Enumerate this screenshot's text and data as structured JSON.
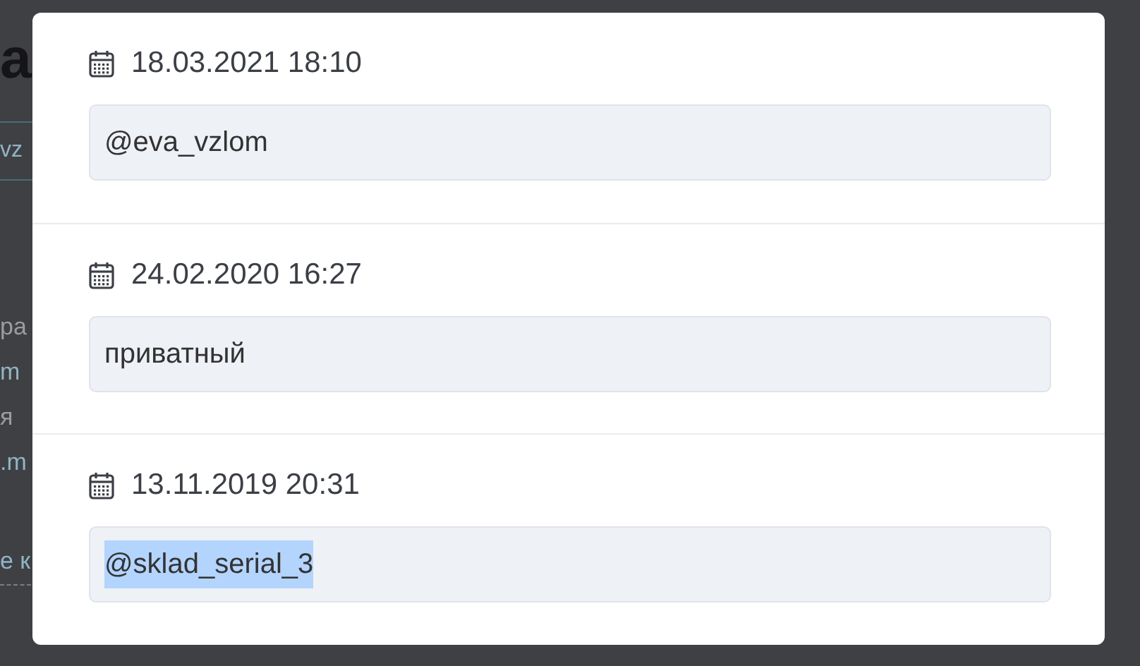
{
  "background_page": {
    "heading": "а",
    "link_box": "vz",
    "lines": [
      {
        "text": "ра",
        "kind": "text"
      },
      {
        "text": "m",
        "kind": "link"
      },
      {
        "text": "я",
        "kind": "text"
      },
      {
        "text": ".m",
        "kind": "link"
      },
      {
        "text": "е к",
        "kind": "dashed_link"
      }
    ]
  },
  "modal": {
    "entries": [
      {
        "date": "18.03.2021 18:10",
        "value": "@eva_vzlom",
        "text_selected": false
      },
      {
        "date": "24.02.2020 16:27",
        "value": "приватный",
        "text_selected": false
      },
      {
        "date": "13.11.2019 20:31",
        "value": "@sklad_serial_3",
        "text_selected": true
      }
    ]
  }
}
